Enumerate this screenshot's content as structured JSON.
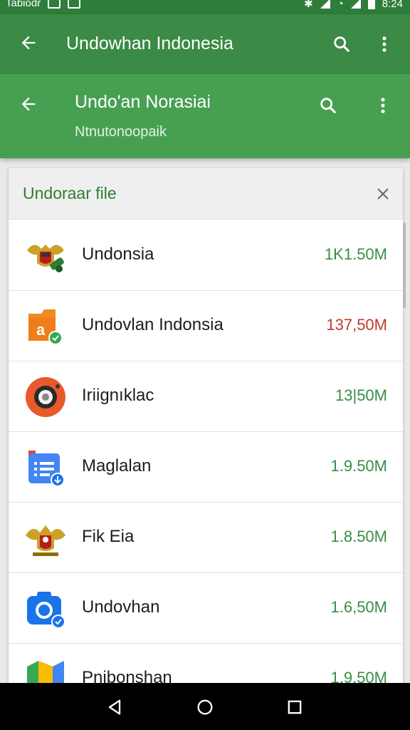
{
  "status_bar": {
    "left_text": "Tabiodr",
    "time": "8:24"
  },
  "appbar_primary": {
    "title": "Undowhan Indonesia"
  },
  "appbar_secondary": {
    "title": "Undo'an Norasiai",
    "subtitle": "Ntnutonoopaik"
  },
  "dialog": {
    "title": "Undoraar file",
    "items": [
      {
        "name": "Undonsia",
        "size": "1K1.50M",
        "icon": "emblem-garuda-icon"
      },
      {
        "name": "Undovlan Indonsia",
        "size": "137,50M",
        "icon": "orange-file-icon"
      },
      {
        "name": "Iriignıklac",
        "size": "13|50M",
        "icon": "camera-lens-icon"
      },
      {
        "name": "Maglalan",
        "size": "1.9.50M",
        "icon": "blue-document-icon"
      },
      {
        "name": "Fik Eia",
        "size": "1.8.50M",
        "icon": "garuda-emblem-icon"
      },
      {
        "name": "Undovhan",
        "size": "1.6,50M",
        "icon": "blue-camera-icon"
      },
      {
        "name": "Pnibonshan",
        "size": "1.9.50M",
        "icon": "maps-icon"
      }
    ]
  },
  "colors": {
    "status_bar": "#2f7d3a",
    "appbar_primary": "#3b8a45",
    "appbar_secondary": "#47a052",
    "accent_text": "#2e7d32",
    "size_alert": "#c0392b"
  }
}
